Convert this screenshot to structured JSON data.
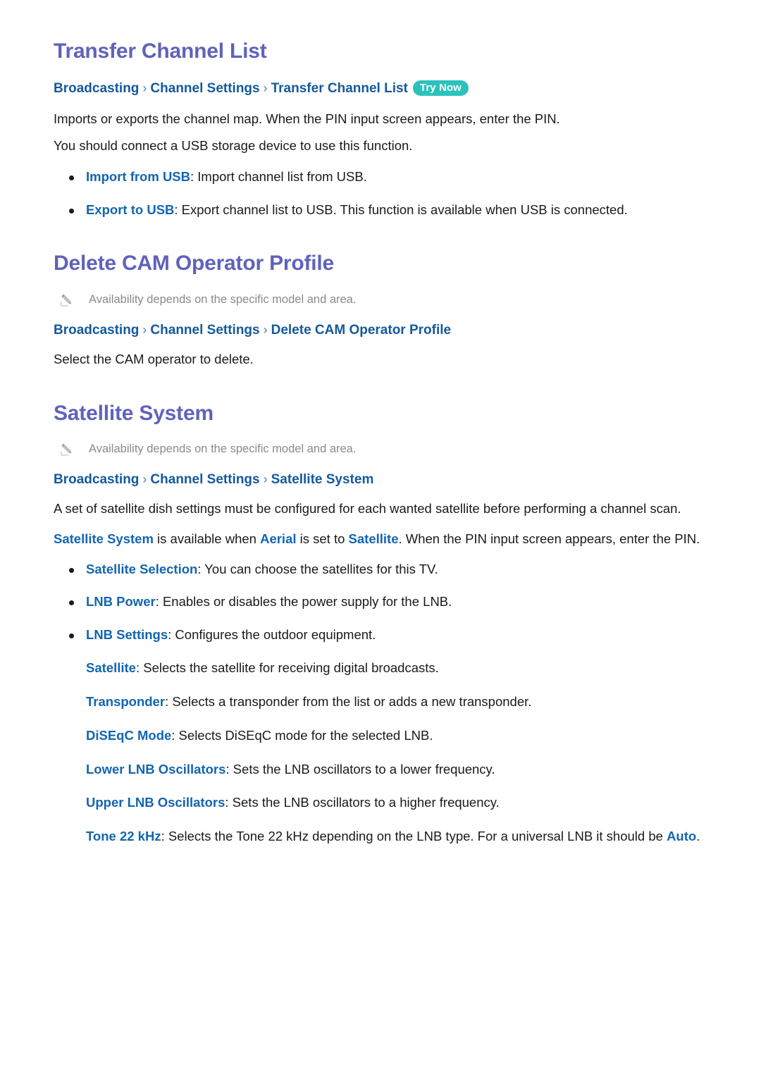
{
  "document": {
    "sections": [
      {
        "id": "transfer-channel-list",
        "title": "Transfer Channel List",
        "has_note": false,
        "breadcrumb": {
          "crumb1": "Broadcasting",
          "sep": "›",
          "crumb2": "Channel Settings",
          "crumb3": "Transfer Channel List",
          "badge": "Try Now"
        },
        "paragraphs": [
          "Imports or exports the channel map. When the PIN input screen appears, enter the PIN.",
          "You should connect a USB storage device to use this function."
        ],
        "bullets": [
          {
            "term": "Import from USB",
            "desc": ": Import channel list from USB."
          },
          {
            "term": "Export to USB",
            "desc": ": Export channel list to USB. This function is available when USB is connected."
          }
        ]
      },
      {
        "id": "delete-cam-operator-profile",
        "title": "Delete CAM Operator Profile",
        "has_note": true,
        "note": "Availability depends on the specific model and area.",
        "breadcrumb": {
          "crumb1": "Broadcasting",
          "sep": "›",
          "crumb2": "Channel Settings",
          "crumb3": "Delete CAM Operator Profile",
          "badge": ""
        },
        "paragraphs": [
          "Select the CAM operator to delete."
        ]
      },
      {
        "id": "satellite-system",
        "title": "Satellite System",
        "has_note": true,
        "note": "Availability depends on the specific model and area.",
        "breadcrumb": {
          "crumb1": "Broadcasting",
          "sep": "›",
          "crumb2": "Channel Settings",
          "crumb3": "Satellite System",
          "badge": ""
        },
        "paragraphs": [
          "A set of satellite dish settings must be configured for each wanted satellite before performing a channel scan."
        ],
        "rich_paragraph": {
          "part1_link": "Satellite System",
          "part2": " is available when ",
          "part3_link": "Aerial",
          "part4": " is set to ",
          "part5_link": "Satellite",
          "part6": ". When the PIN input screen appears, enter the PIN."
        },
        "bullets": [
          {
            "term": "Satellite Selection",
            "desc": ": You can choose the satellites for this TV."
          },
          {
            "term": "LNB Power",
            "desc": ": Enables or disables the power supply for the LNB."
          },
          {
            "term": "LNB Settings",
            "desc": ": Configures the outdoor equipment."
          }
        ],
        "sub_items": [
          {
            "term": "Satellite",
            "desc": ": Selects the satellite for receiving digital broadcasts."
          },
          {
            "term": "Transponder",
            "desc": ": Selects a transponder from the list or adds a new transponder."
          },
          {
            "term": "DiSEqC Mode",
            "desc": ": Selects DiSEqC mode for the selected LNB."
          },
          {
            "term": "Lower LNB Oscillators",
            "desc": ": Sets the LNB oscillators to a lower frequency."
          },
          {
            "term": "Upper LNB Oscillators",
            "desc": ": Sets the LNB oscillators to a higher frequency."
          }
        ],
        "tone_item": {
          "term": "Tone 22 kHz",
          "desc_part1": ": Selects the Tone 22 kHz depending on the LNB type. For a universal LNB it should be ",
          "desc_link": "Auto",
          "desc_part2": "."
        }
      }
    ],
    "icons": {
      "note_icon": "pencil-icon",
      "bullet_icon": "bullet-dot-icon",
      "breadcrumb_separator_icon": "chevron-right-icon"
    },
    "colors": {
      "heading": "#5f62bb",
      "breadcrumb": "#14599e",
      "link": "#1365b0",
      "badge_bg": "#2bc2bd",
      "note_text": "#8a8a8a",
      "body_text": "#1a1a1a"
    }
  }
}
